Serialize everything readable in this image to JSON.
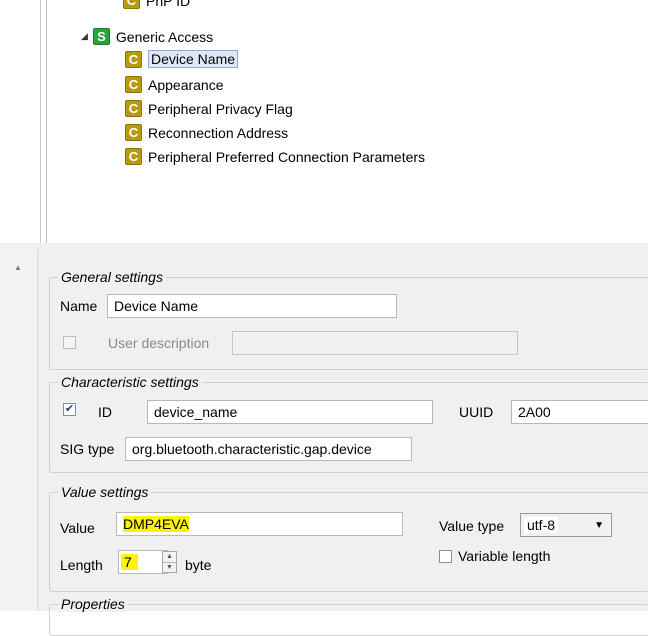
{
  "tree": {
    "partial_item": "PnP ID",
    "service": {
      "badge": "S",
      "label": "Generic Access"
    },
    "characteristics": [
      {
        "badge": "C",
        "label": "Device Name"
      },
      {
        "badge": "C",
        "label": "Appearance"
      },
      {
        "badge": "C",
        "label": "Peripheral Privacy Flag"
      },
      {
        "badge": "C",
        "label": "Reconnection Address"
      },
      {
        "badge": "C",
        "label": "Peripheral Preferred Connection Parameters"
      }
    ]
  },
  "general": {
    "legend": "General settings",
    "name_label": "Name",
    "name_value": "Device Name",
    "user_desc_label": "User description",
    "user_desc_value": ""
  },
  "characteristic": {
    "legend": "Characteristic settings",
    "id_label": "ID",
    "id_value": "device_name",
    "uuid_label": "UUID",
    "uuid_value": "2A00",
    "sig_label": "SIG type",
    "sig_value": "org.bluetooth.characteristic.gap.device",
    "id_checked": true
  },
  "value": {
    "legend": "Value settings",
    "value_label": "Value",
    "value_value": "DMP4EVA",
    "type_label": "Value type",
    "type_value": "utf-8",
    "length_label": "Length",
    "length_value": "7",
    "length_unit": "byte",
    "variable_label": "Variable length",
    "variable_checked": false
  },
  "properties": {
    "legend": "Properties"
  },
  "colors": {
    "char_badge": "#b89a13",
    "service_badge": "#2aa33b",
    "highlight": "#fdf20c"
  }
}
